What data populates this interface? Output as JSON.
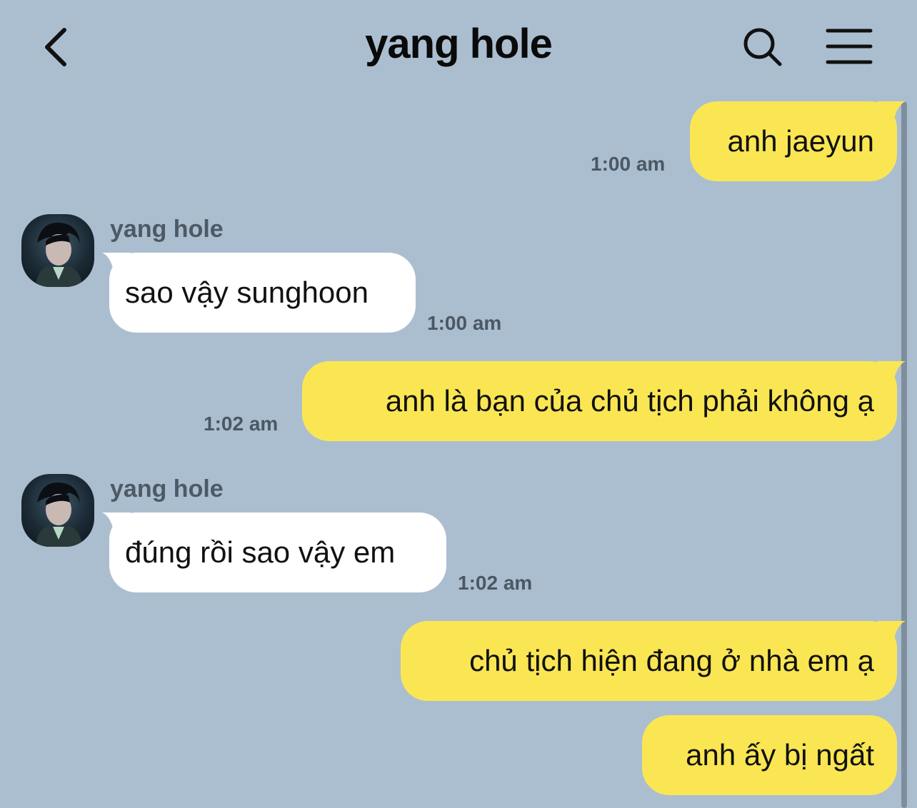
{
  "header": {
    "title": "yang hole",
    "back_icon": "chevron-left-icon",
    "search_icon": "search-icon",
    "menu_icon": "hamburger-menu-icon"
  },
  "colors": {
    "background": "#abbed0",
    "my_bubble": "#fae653",
    "their_bubble": "#ffffff"
  },
  "messages": [
    {
      "from": "me",
      "text": "anh jaeyun",
      "time": "1:00 am"
    },
    {
      "from": "them",
      "sender": "yang hole",
      "text": "sao vậy sunghoon",
      "time": "1:00 am"
    },
    {
      "from": "me",
      "text": "anh là bạn của chủ tịch phải không ạ",
      "time": "1:02 am"
    },
    {
      "from": "them",
      "sender": "yang hole",
      "text": "đúng rồi sao vậy em",
      "time": "1:02 am"
    },
    {
      "from": "me",
      "text": "chủ tịch hiện đang ở nhà em ạ"
    },
    {
      "from": "me",
      "text": "anh ấy bị ngất"
    }
  ]
}
